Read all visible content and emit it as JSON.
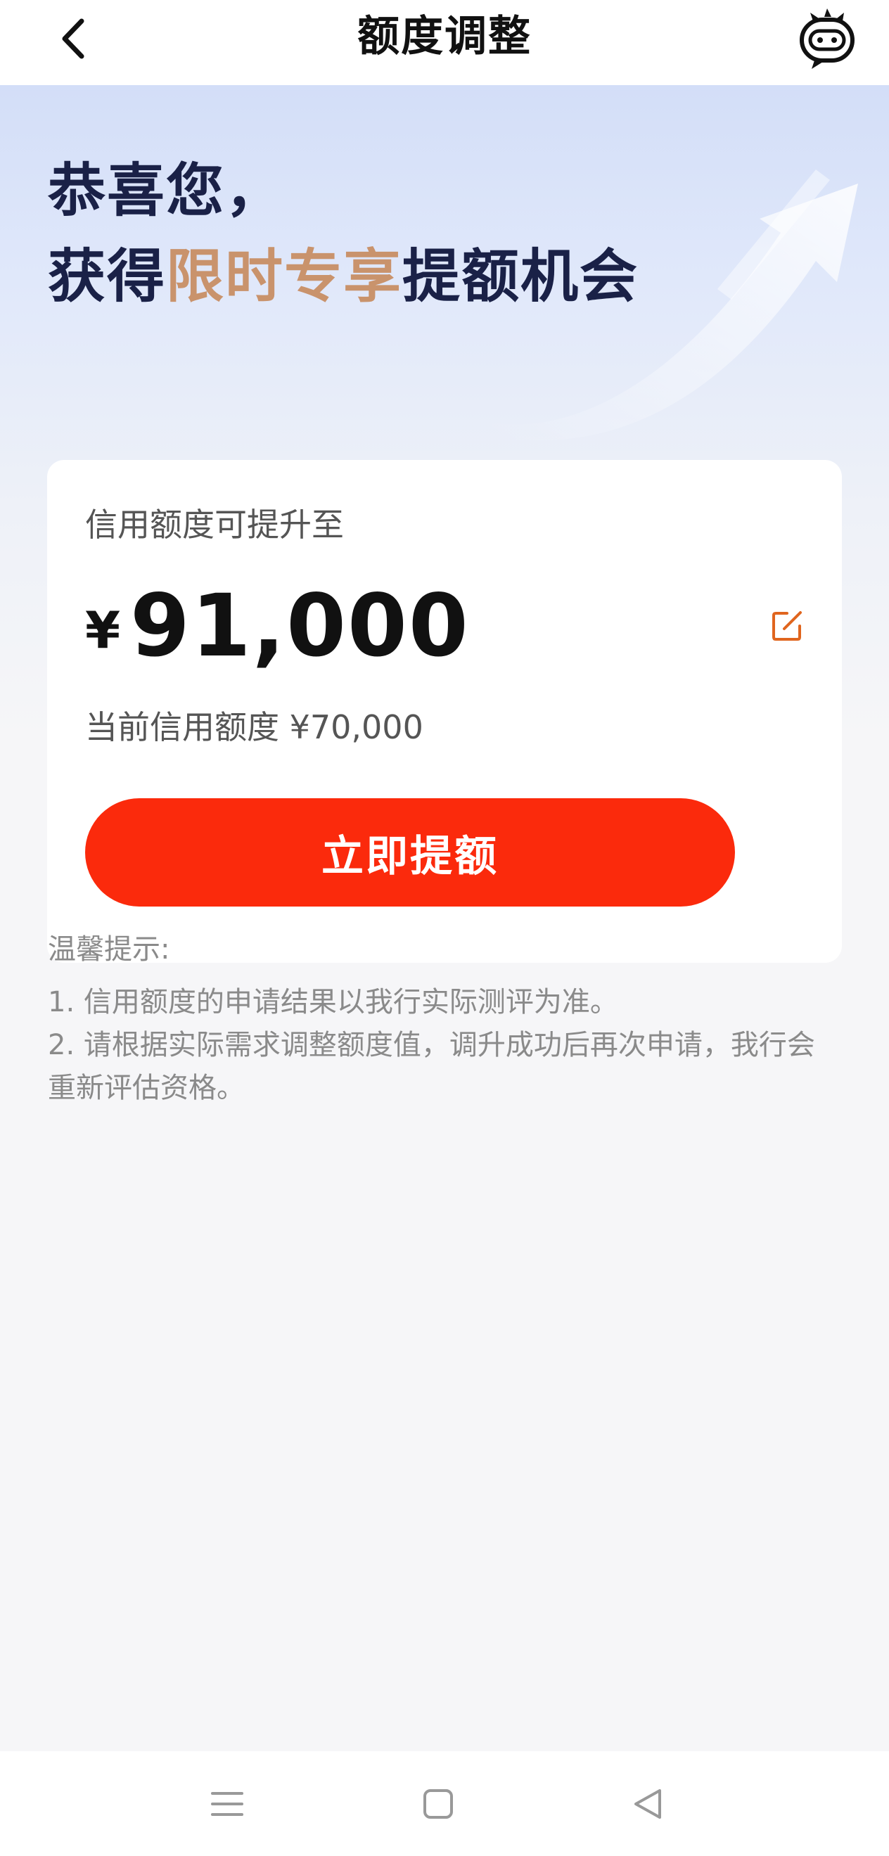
{
  "header": {
    "title": "额度调整",
    "back_icon": "chevron-left-icon",
    "service_icon": "customer-service-robot-icon"
  },
  "hero": {
    "line1": "恭喜您，",
    "line2_prefix": "获得",
    "line2_highlight": "限时专享",
    "line2_suffix": "提额机会"
  },
  "card": {
    "label": "信用额度可提升至",
    "currency": "¥",
    "amount": "91,000",
    "edit_icon": "edit-icon",
    "current_limit": "当前信用额度 ¥70,000",
    "button_label": "立即提额"
  },
  "tips": {
    "title": "温馨提示:",
    "items": [
      "1. 信用额度的申请结果以我行实际测评为准。",
      "2. 请根据实际需求调整额度值，调升成功后再次申请，我行会重新评估资格。"
    ]
  },
  "colors": {
    "accent": "#fb2a0c",
    "highlight": "#c9936c",
    "headline": "#1a2147",
    "edit_icon": "#e0651e"
  },
  "nav": {
    "menu_icon": "menu-icon",
    "home_icon": "home-square-icon",
    "back_icon": "back-triangle-icon"
  }
}
